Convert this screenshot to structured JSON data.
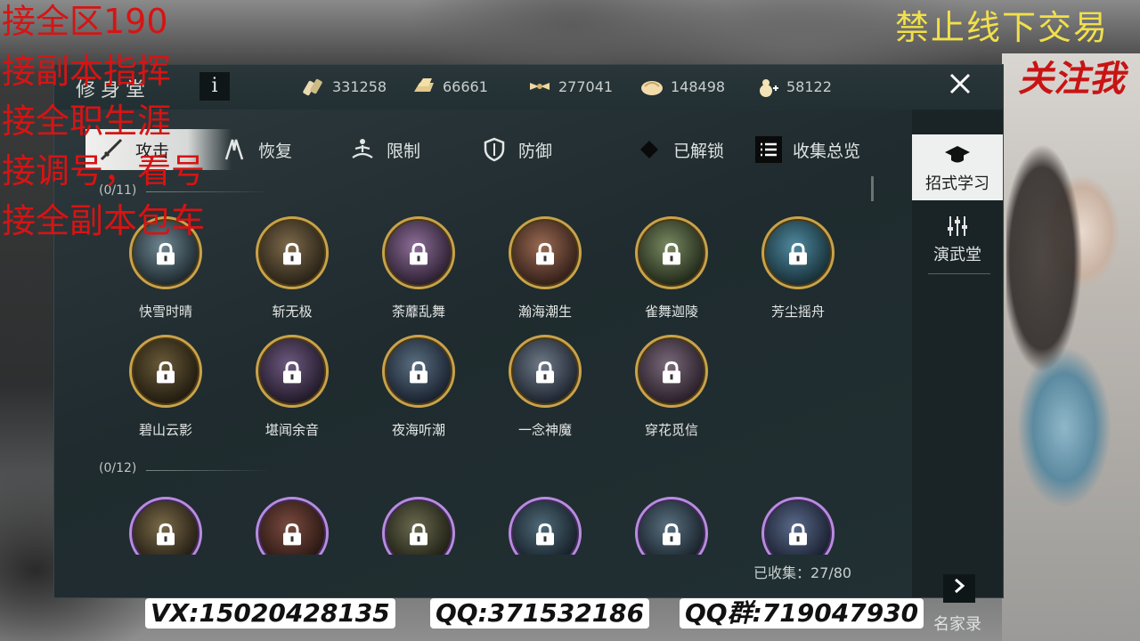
{
  "panel": {
    "title": "修身堂",
    "info_label": "i"
  },
  "currencies": [
    {
      "icon": "silver-ingot-icon",
      "value": "331258"
    },
    {
      "icon": "gold-bar-icon",
      "value": "66661"
    },
    {
      "icon": "ribbon-icon",
      "value": "277041"
    },
    {
      "icon": "bun-icon",
      "value": "148498"
    },
    {
      "icon": "gourd-icon",
      "value": "58122"
    }
  ],
  "tabs": [
    {
      "label": "攻击",
      "icon": "sword-icon"
    },
    {
      "label": "恢复",
      "icon": "hands-icon"
    },
    {
      "label": "限制",
      "icon": "meditation-icon"
    },
    {
      "label": "防御",
      "icon": "shield-icon"
    },
    {
      "label": "已解锁",
      "icon": "diamond-icon"
    },
    {
      "label": "收集总览",
      "icon": "list-icon"
    }
  ],
  "side_menu": [
    {
      "label": "招式学习",
      "icon": "scholar-hat-icon"
    },
    {
      "label": "演武堂",
      "icon": "sliders-icon"
    },
    {
      "label": "名家录",
      "icon": "chevron-right-icon"
    }
  ],
  "sections": [
    {
      "label": "(0/11)",
      "skills": [
        "快雪时晴",
        "斩无极",
        "荼蘼乱舞",
        "瀚海潮生",
        "雀舞迦陵",
        "芳尘摇舟",
        "碧山云影",
        "堪闻余音",
        "夜海听潮",
        "一念神魔",
        "穿花觅信"
      ]
    },
    {
      "label": "(0/12)",
      "skills": [
        "",
        "",
        "",
        "",
        "",
        ""
      ]
    }
  ],
  "collected": "已收集：27/80",
  "overlay": {
    "red_lines": [
      "接全区190",
      "接副本指挥",
      "接全职生涯",
      "接调号，看号",
      "接全副本包车"
    ],
    "yellow": "禁止线下交易",
    "follow": "关注我",
    "contacts": [
      "VX:15020428135",
      "QQ:371532186",
      "QQ群:719047930"
    ]
  },
  "colors": {
    "gold_ring": "#c9a24a",
    "purple_ring": "#b98be0",
    "overlay_red": "#d61414",
    "overlay_yellow": "#f1e04a"
  }
}
